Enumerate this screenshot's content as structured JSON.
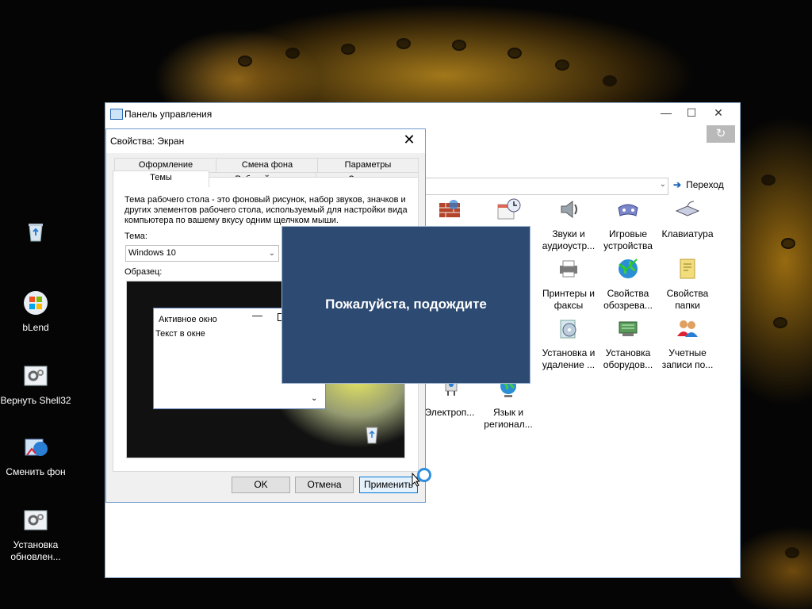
{
  "desktop": {
    "icons": [
      {
        "label": "",
        "icon": "recycle-bin-icon"
      },
      {
        "label": "bLend",
        "icon": "windows-logo-icon"
      },
      {
        "label": "Вернуть Shell32",
        "icon": "settings-gear-icon"
      },
      {
        "label": "Сменить фон",
        "icon": "change-wallpaper-icon"
      },
      {
        "label": "Установка обновлен...",
        "icon": "settings-gear-icon"
      }
    ]
  },
  "control_panel": {
    "title": "Панель управления",
    "go_label": "Переход",
    "items": [
      {
        "label": "",
        "icon": "firewall-icon"
      },
      {
        "label": "",
        "icon": "scheduled-tasks-icon"
      },
      {
        "label": "Звуки и аудиоустр...",
        "icon": "speaker-icon"
      },
      {
        "label": "Игровые устройства",
        "icon": "gamepad-icon"
      },
      {
        "label": "Клавиатура",
        "icon": "keyboard-icon"
      },
      {
        "label": "Принтеры и факсы",
        "icon": "printer-icon"
      },
      {
        "label": "Свойства обозрева...",
        "icon": "internet-options-icon"
      },
      {
        "label": "Свойства папки",
        "icon": "folder-options-icon"
      },
      {
        "label": "Установка и удаление ...",
        "icon": "add-remove-programs-icon"
      },
      {
        "label": "Установка оборудов...",
        "icon": "add-hardware-icon"
      },
      {
        "label": "Учетные записи по...",
        "icon": "user-accounts-icon"
      },
      {
        "label": "Электроп...",
        "icon": "power-options-icon"
      },
      {
        "label": "Язык и регионал...",
        "icon": "regional-globe-icon"
      }
    ]
  },
  "dialog": {
    "title": "Свойства: Экран",
    "tabs_top": [
      "Оформление",
      "Смена фона",
      "Параметры"
    ],
    "tabs_bottom": [
      "Темы",
      "Рабочий стол",
      "Заставка"
    ],
    "active_tab": "Темы",
    "description": "Тема рабочего стола - это фоновый рисунок, набор звуков, значков и других элементов рабочего стола, используемый для настройки вида компьютера по вашему вкусу одним щелчком мыши.",
    "theme_label": "Тема:",
    "theme_value": "Windows 10",
    "sample_label": "Образец:",
    "sample_window_title": "Активное окно",
    "sample_window_text": "Текст в окне",
    "buttons": {
      "ok": "OK",
      "cancel": "Отмена",
      "apply": "Применить"
    }
  },
  "wait_overlay": {
    "text": "Пожалуйста, подождите"
  },
  "colors": {
    "overlay": "#2d4a72",
    "accent": "#0078d7",
    "desktop": "#050505"
  }
}
